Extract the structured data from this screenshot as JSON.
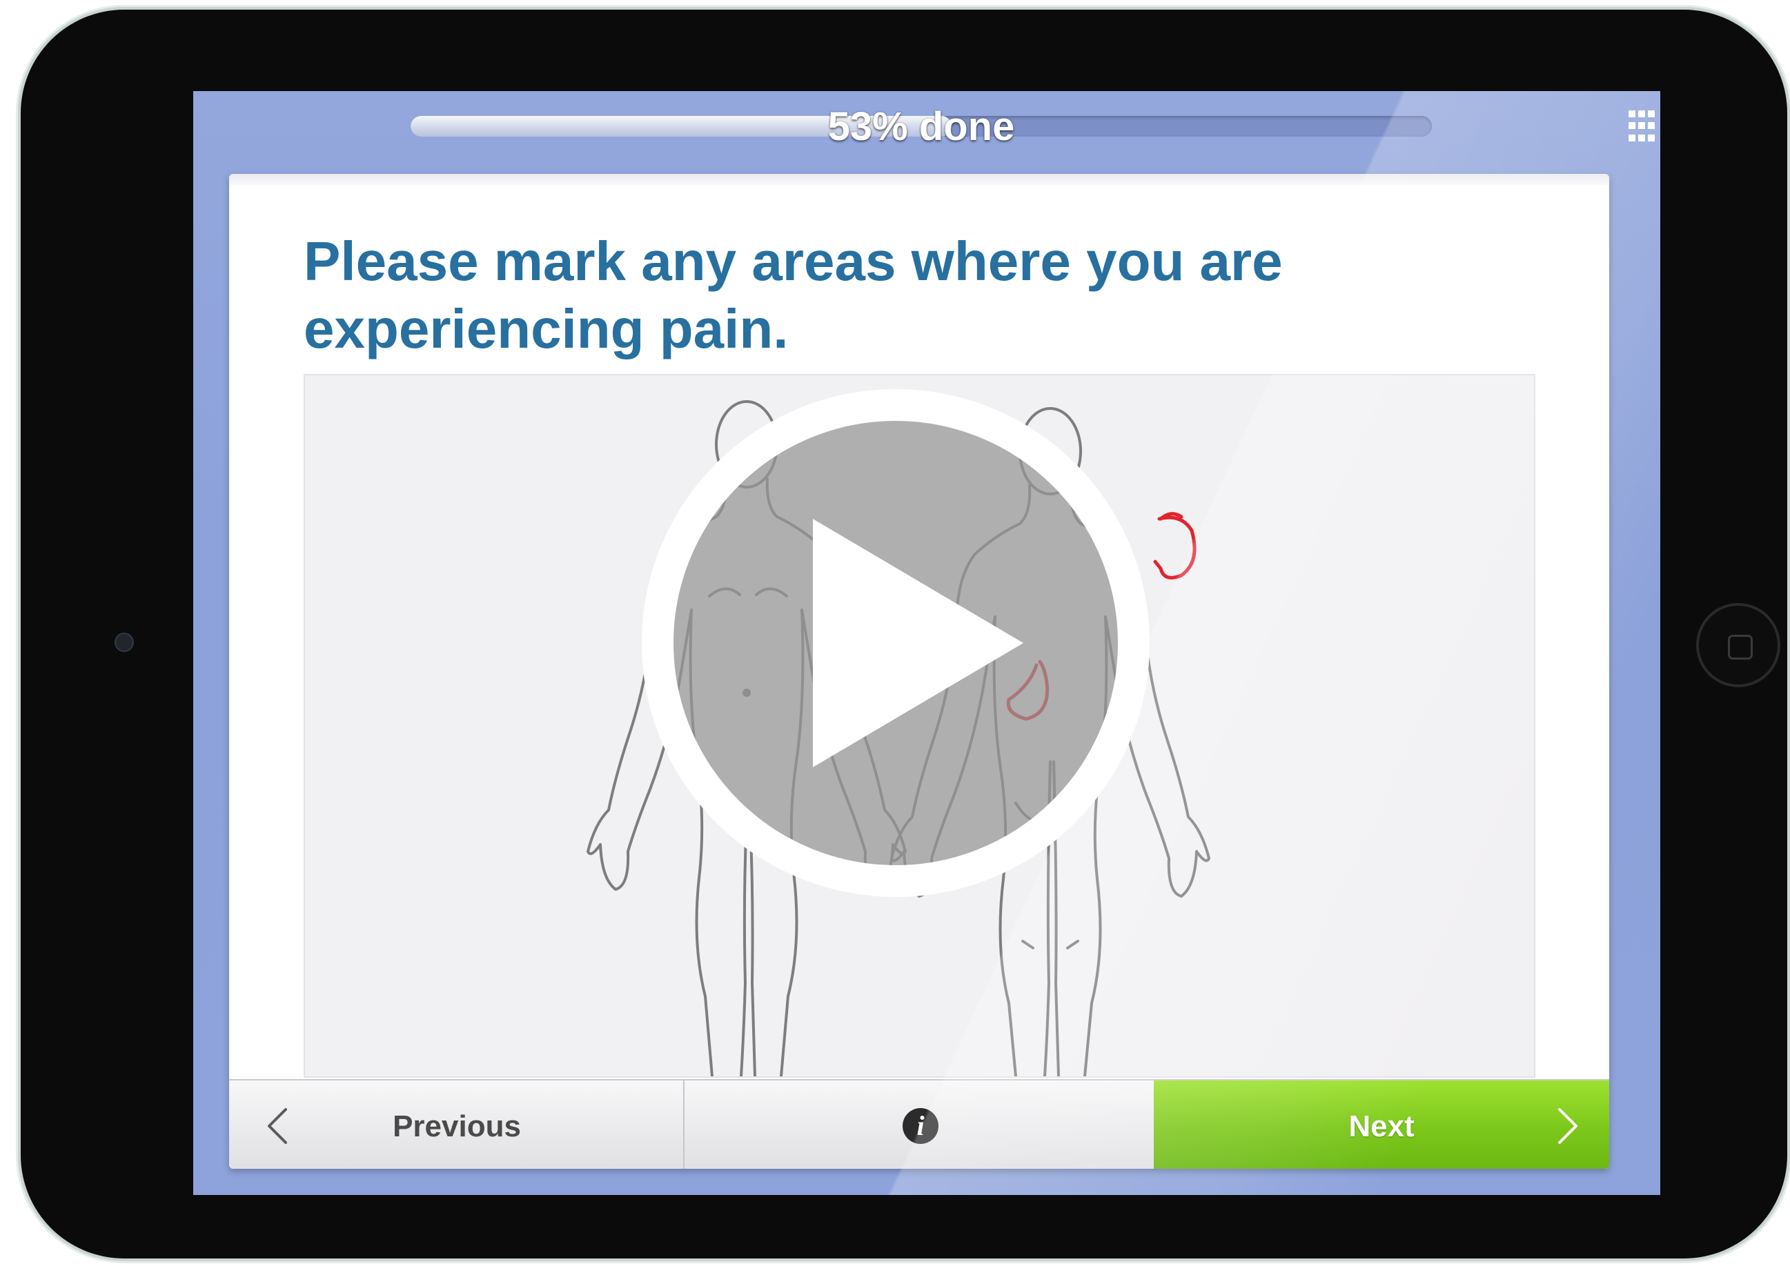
{
  "progress": {
    "label": "53% done",
    "fraction": 0.53
  },
  "question": {
    "text": "Please mark any areas where you are experiencing pain."
  },
  "navigation": {
    "previous_label": "Previous",
    "next_label": "Next",
    "info_glyph": "i"
  },
  "icons": {
    "menu": "grid-menu-icon",
    "previous": "chevron-left-icon",
    "next": "chevron-right-icon",
    "info": "info-icon",
    "play": "play-icon"
  },
  "colors": {
    "question_text": "#27709f",
    "next_button": "#7cc71b",
    "pain_marks": "#e0242e",
    "screen_background": "#8ea3db"
  }
}
